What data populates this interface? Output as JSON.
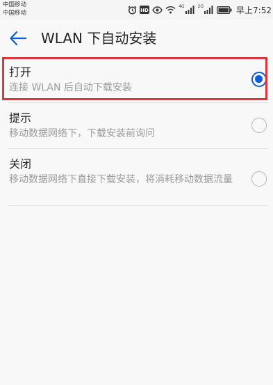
{
  "status_bar": {
    "carrier_1": "中国移动",
    "carrier_2": "中国移动",
    "sig_tag_1": "4G",
    "sig_tag_2": "2G",
    "time": "早上7:52"
  },
  "header": {
    "title": "WLAN 下自动安装"
  },
  "options": [
    {
      "label": "打开",
      "description": "连接 WLAN 后自动下载安装",
      "selected": true
    },
    {
      "label": "提示",
      "description": "移动数据网络下，下载安装前询问",
      "selected": false
    },
    {
      "label": "关闭",
      "description": "移动数据网络下直接下载安装，将消耗移动数据流量",
      "selected": false
    }
  ],
  "colors": {
    "accent": "#0a5dd8",
    "highlight": "#e0343b"
  }
}
